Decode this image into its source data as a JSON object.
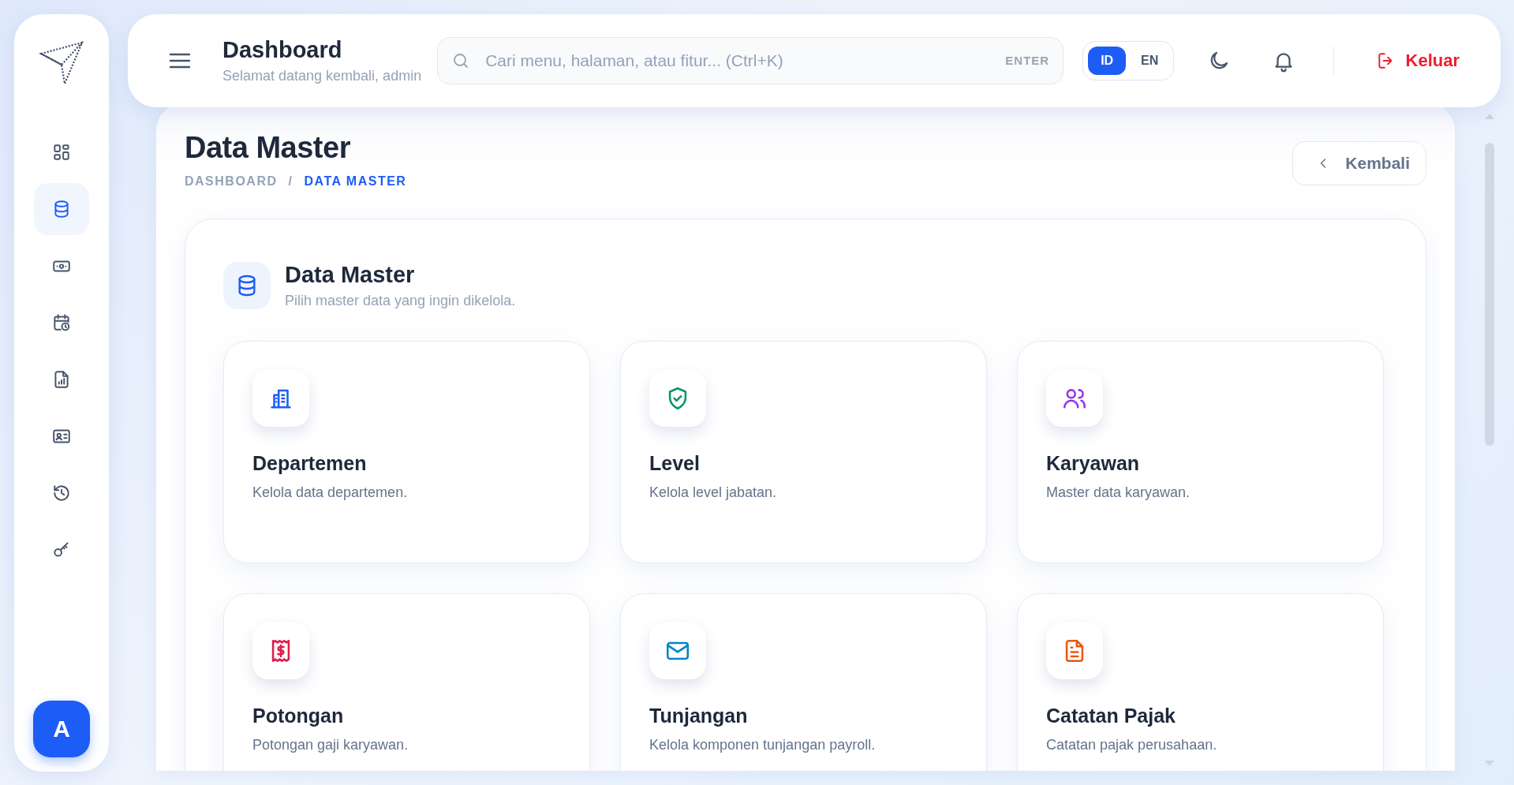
{
  "sidebar": {
    "items": [
      {
        "selected": false
      },
      {
        "selected": true
      },
      {
        "selected": false
      },
      {
        "selected": false
      },
      {
        "selected": false
      },
      {
        "selected": false
      },
      {
        "selected": false
      },
      {
        "selected": false
      }
    ],
    "avatar": "A"
  },
  "header": {
    "title": "Dashboard",
    "subtitle": "Selamat datang kembali, admin",
    "search": {
      "placeholder": "Cari menu, halaman, atau fitur... (Ctrl+K)",
      "shortcut": "ENTER"
    },
    "languages": [
      {
        "label": "ID",
        "selected": true
      },
      {
        "label": "EN",
        "selected": false
      }
    ],
    "logout": "Keluar"
  },
  "page": {
    "title": "Data Master",
    "breadcrumb": {
      "separator": "/",
      "items": [
        {
          "label": "DASHBOARD",
          "selected": false
        },
        {
          "label": "DATA MASTER",
          "selected": true
        }
      ]
    },
    "back_button": "Kembali"
  },
  "panel": {
    "title": "Data Master",
    "subtitle": "Pilih master data yang ingin dikelola.",
    "cards": [
      {
        "title": "Departemen",
        "description": "Kelola data departemen.",
        "color": "#1d5cf5"
      },
      {
        "title": "Level",
        "description": "Kelola level jabatan.",
        "color": "#059669"
      },
      {
        "title": "Karyawan",
        "description": "Master data karyawan.",
        "color": "#9333ea"
      },
      {
        "title": "Potongan",
        "description": "Potongan gaji karyawan.",
        "color": "#e11d48"
      },
      {
        "title": "Tunjangan",
        "description": "Kelola komponen tunjangan payroll.",
        "color": "#0284c7"
      },
      {
        "title": "Catatan Pajak",
        "description": "Catatan pajak perusahaan.",
        "color": "#ea580c"
      }
    ]
  }
}
